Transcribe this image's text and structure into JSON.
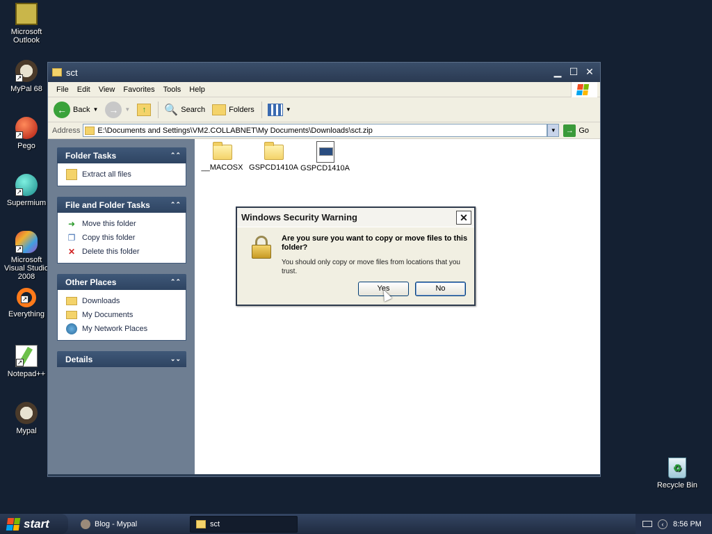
{
  "desktop": {
    "icons": [
      {
        "label": "Microsoft Outlook"
      },
      {
        "label": "MyPal 68"
      },
      {
        "label": "Pego"
      },
      {
        "label": "Supermium"
      },
      {
        "label": "Microsoft Visual Studio 2008"
      },
      {
        "label": "Everything"
      },
      {
        "label": "Notepad++"
      },
      {
        "label": "Mypal"
      },
      {
        "label": "Recycle Bin"
      }
    ]
  },
  "window": {
    "title": "sct",
    "menu": [
      "File",
      "Edit",
      "View",
      "Favorites",
      "Tools",
      "Help"
    ],
    "toolbar": {
      "back": "Back",
      "search": "Search",
      "folders": "Folders"
    },
    "address": {
      "label": "Address",
      "value": "E:\\Documents and Settings\\VM2.COLLABNET\\My Documents\\Downloads\\sct.zip",
      "go": "Go"
    },
    "panels": {
      "folder_tasks": {
        "title": "Folder Tasks",
        "items": [
          "Extract all files"
        ]
      },
      "file_folder_tasks": {
        "title": "File and Folder Tasks",
        "items": [
          "Move this folder",
          "Copy this folder",
          "Delete this folder"
        ]
      },
      "other_places": {
        "title": "Other Places",
        "items": [
          "Downloads",
          "My Documents",
          "My Network Places"
        ]
      },
      "details": {
        "title": "Details"
      }
    },
    "files": [
      {
        "name": "__MACOSX",
        "type": "folder"
      },
      {
        "name": "GSPCD1410A",
        "type": "folder"
      },
      {
        "name": "GSPCD1410A",
        "type": "file"
      }
    ]
  },
  "dialog": {
    "title": "Windows Security Warning",
    "question": "Are you sure you want to copy or move files to this folder?",
    "detail": "You should only copy or move files from locations that you trust.",
    "yes": "Yes",
    "no": "No"
  },
  "taskbar": {
    "start": "start",
    "tasks": [
      "Blog - Mypal",
      "sct"
    ],
    "clock": "8:56 PM"
  }
}
